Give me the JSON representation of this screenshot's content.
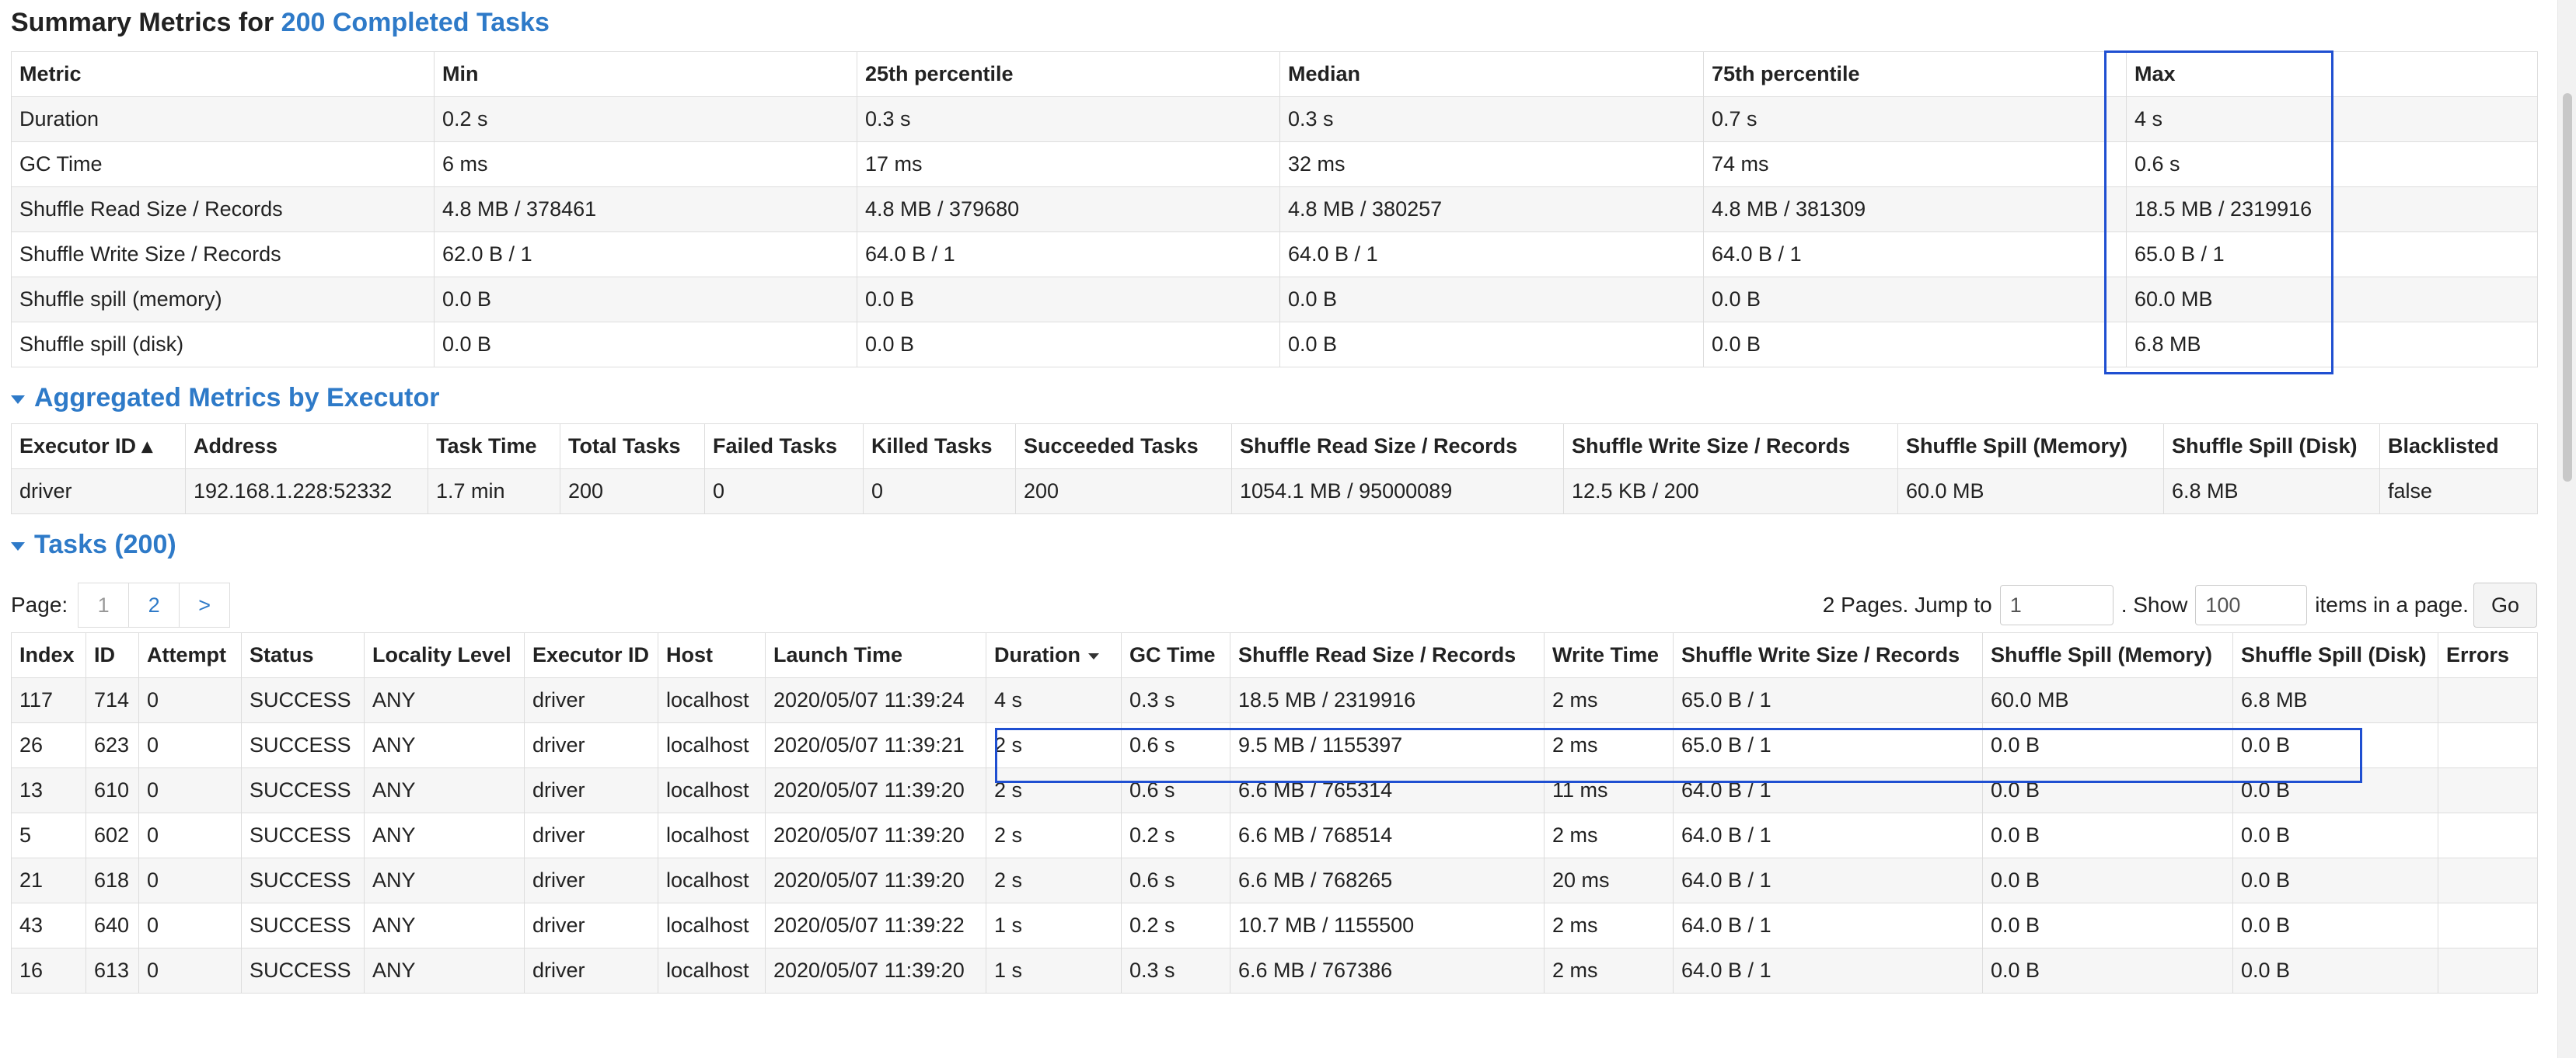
{
  "summary": {
    "title_prefix": "Summary Metrics for ",
    "title_link": "200 Completed Tasks",
    "columns": [
      "Metric",
      "Min",
      "25th percentile",
      "Median",
      "75th percentile",
      "Max"
    ],
    "rows": [
      [
        "Duration",
        "0.2 s",
        "0.3 s",
        "0.3 s",
        "0.7 s",
        "4 s"
      ],
      [
        "GC Time",
        "6 ms",
        "17 ms",
        "32 ms",
        "74 ms",
        "0.6 s"
      ],
      [
        "Shuffle Read Size / Records",
        "4.8 MB / 378461",
        "4.8 MB / 379680",
        "4.8 MB / 380257",
        "4.8 MB / 381309",
        "18.5 MB / 2319916"
      ],
      [
        "Shuffle Write Size / Records",
        "62.0 B / 1",
        "64.0 B / 1",
        "64.0 B / 1",
        "64.0 B / 1",
        "65.0 B / 1"
      ],
      [
        "Shuffle spill (memory)",
        "0.0 B",
        "0.0 B",
        "0.0 B",
        "0.0 B",
        "60.0 MB"
      ],
      [
        "Shuffle spill (disk)",
        "0.0 B",
        "0.0 B",
        "0.0 B",
        "0.0 B",
        "6.8 MB"
      ]
    ]
  },
  "executors": {
    "title": "Aggregated Metrics by Executor",
    "columns": [
      "Executor ID ▴",
      "Address",
      "Task Time",
      "Total Tasks",
      "Failed Tasks",
      "Killed Tasks",
      "Succeeded Tasks",
      "Shuffle Read Size / Records",
      "Shuffle Write Size / Records",
      "Shuffle Spill (Memory)",
      "Shuffle Spill (Disk)",
      "Blacklisted"
    ],
    "rows": [
      [
        "driver",
        "192.168.1.228:52332",
        "1.7 min",
        "200",
        "0",
        "0",
        "200",
        "1054.1 MB / 95000089",
        "12.5 KB / 200",
        "60.0 MB",
        "6.8 MB",
        "false"
      ]
    ]
  },
  "tasks": {
    "title": "Tasks (200)",
    "pager": {
      "page_label": "Page:",
      "pages": [
        "1",
        "2",
        ">"
      ],
      "pages_text": "2 Pages. Jump to",
      "jump_value": "1",
      "show_text": ". Show",
      "show_value": "100",
      "items_text": "items in a page.",
      "go_label": "Go"
    },
    "columns": [
      "Index",
      "ID",
      "Attempt",
      "Status",
      "Locality Level",
      "Executor ID",
      "Host",
      "Launch Time",
      "Duration",
      "GC Time",
      "Shuffle Read Size / Records",
      "Write Time",
      "Shuffle Write Size / Records",
      "Shuffle Spill (Memory)",
      "Shuffle Spill (Disk)",
      "Errors"
    ],
    "rows": [
      [
        "117",
        "714",
        "0",
        "SUCCESS",
        "ANY",
        "driver",
        "localhost",
        "2020/05/07 11:39:24",
        "4 s",
        "0.3 s",
        "18.5 MB / 2319916",
        "2 ms",
        "65.0 B / 1",
        "60.0 MB",
        "6.8 MB",
        ""
      ],
      [
        "26",
        "623",
        "0",
        "SUCCESS",
        "ANY",
        "driver",
        "localhost",
        "2020/05/07 11:39:21",
        "2 s",
        "0.6 s",
        "9.5 MB / 1155397",
        "2 ms",
        "65.0 B / 1",
        "0.0 B",
        "0.0 B",
        ""
      ],
      [
        "13",
        "610",
        "0",
        "SUCCESS",
        "ANY",
        "driver",
        "localhost",
        "2020/05/07 11:39:20",
        "2 s",
        "0.6 s",
        "6.6 MB / 765314",
        "11 ms",
        "64.0 B / 1",
        "0.0 B",
        "0.0 B",
        ""
      ],
      [
        "5",
        "602",
        "0",
        "SUCCESS",
        "ANY",
        "driver",
        "localhost",
        "2020/05/07 11:39:20",
        "2 s",
        "0.2 s",
        "6.6 MB / 768514",
        "2 ms",
        "64.0 B / 1",
        "0.0 B",
        "0.0 B",
        ""
      ],
      [
        "21",
        "618",
        "0",
        "SUCCESS",
        "ANY",
        "driver",
        "localhost",
        "2020/05/07 11:39:20",
        "2 s",
        "0.6 s",
        "6.6 MB / 768265",
        "20 ms",
        "64.0 B / 1",
        "0.0 B",
        "0.0 B",
        ""
      ],
      [
        "43",
        "640",
        "0",
        "SUCCESS",
        "ANY",
        "driver",
        "localhost",
        "2020/05/07 11:39:22",
        "1 s",
        "0.2 s",
        "10.7 MB / 1155500",
        "2 ms",
        "64.0 B / 1",
        "0.0 B",
        "0.0 B",
        ""
      ],
      [
        "16",
        "613",
        "0",
        "SUCCESS",
        "ANY",
        "driver",
        "localhost",
        "2020/05/07 11:39:20",
        "1 s",
        "0.3 s",
        "6.6 MB / 767386",
        "2 ms",
        "64.0 B / 1",
        "0.0 B",
        "0.0 B",
        ""
      ]
    ]
  },
  "colors": {
    "link": "#2e7ac8",
    "highlight": "#1f4fd1",
    "stripe": "#f6f6f6",
    "border": "#dddddd"
  }
}
